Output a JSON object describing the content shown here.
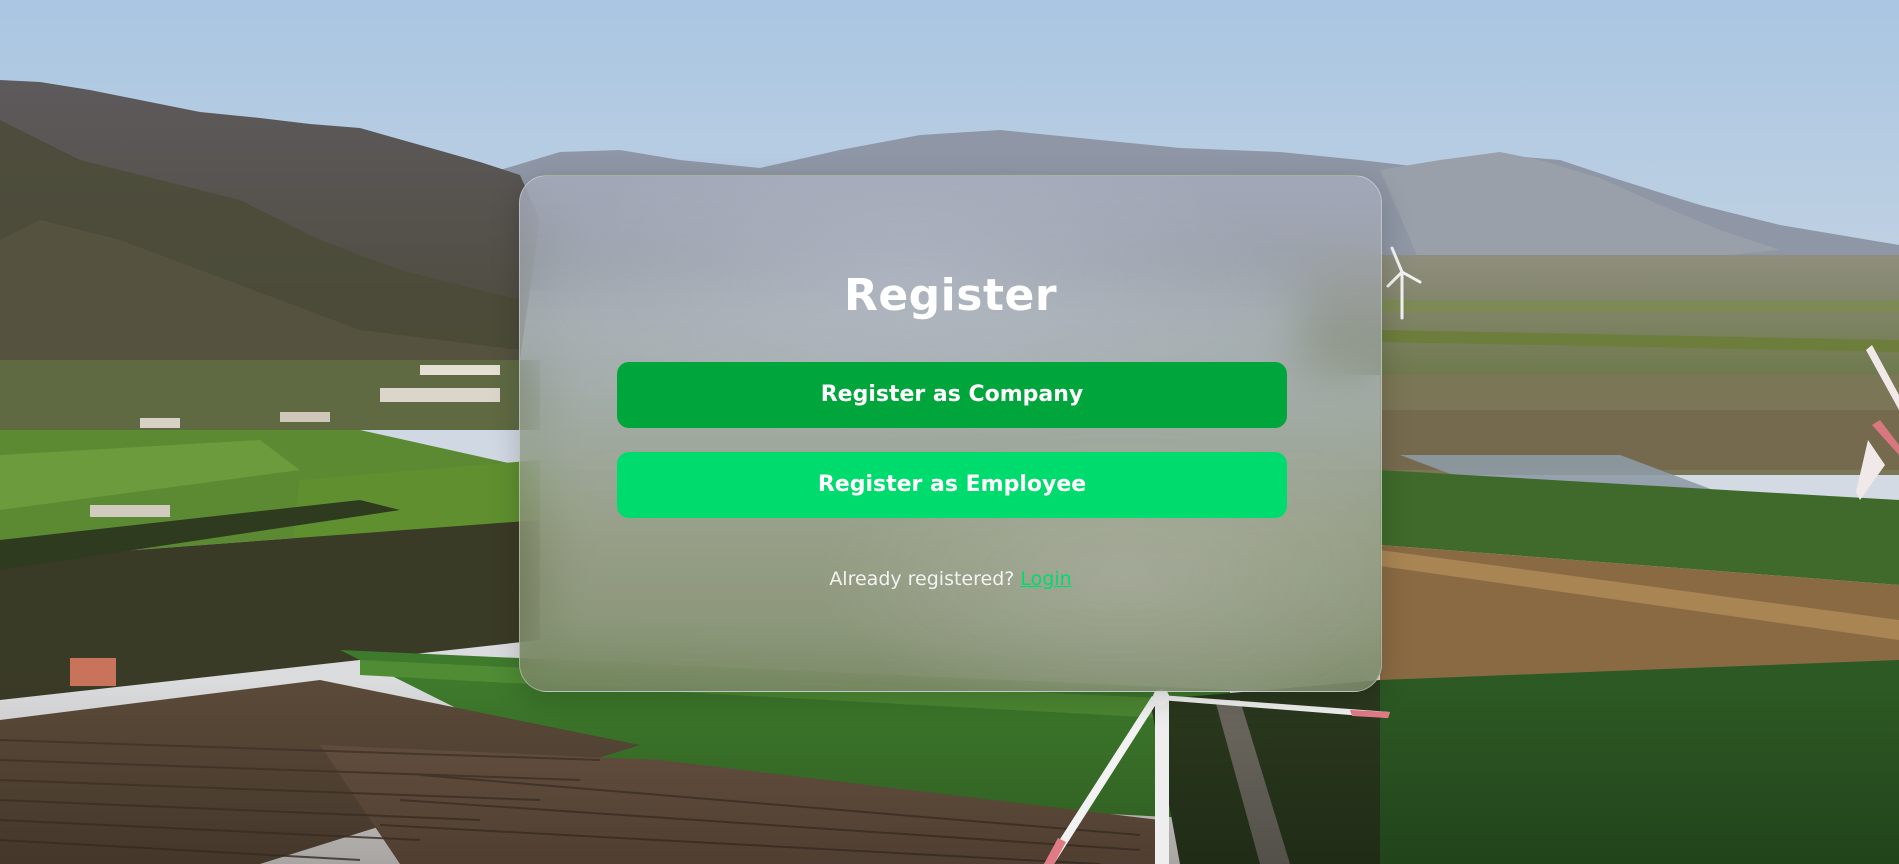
{
  "register": {
    "title": "Register",
    "company_button": "Register as Company",
    "employee_button": "Register as Employee",
    "login_prompt": "Already registered?",
    "login_link": "Login"
  },
  "colors": {
    "company_button": "#00a63c",
    "employee_button": "#00db6d",
    "login_link": "#00db6d",
    "text": "#ffffff"
  },
  "background": {
    "icons": [
      "mountains",
      "farm-fields",
      "wind-turbine"
    ]
  }
}
